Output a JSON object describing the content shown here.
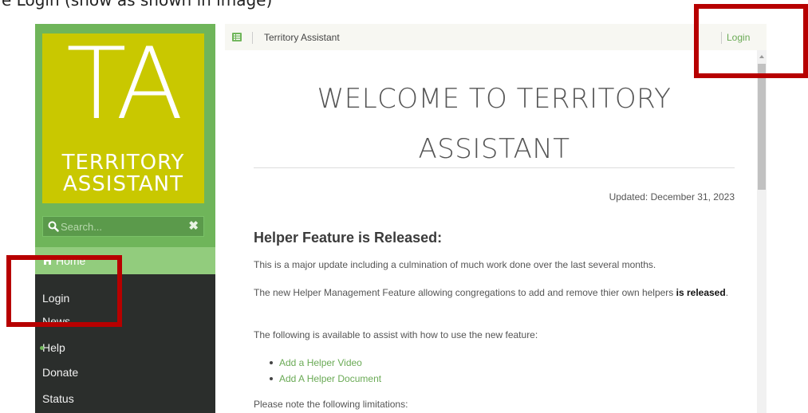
{
  "caption": "e Login (show as shown in image)",
  "sidebar": {
    "logo_big": "TA",
    "logo_line1": "TERRITORY",
    "logo_line2": "ASSISTANT",
    "search_placeholder": "Search...",
    "clear_glyph": "✖",
    "home_label": "Home",
    "items": [
      {
        "label": "Login"
      },
      {
        "label": "News"
      },
      {
        "label": "Help"
      },
      {
        "label": "Donate"
      },
      {
        "label": "Status"
      }
    ]
  },
  "header": {
    "title": "Territory Assistant",
    "login": "Login"
  },
  "content": {
    "heading_line1": "WELCOME TO TERRITORY",
    "heading_line2": "ASSISTANT",
    "updated": "Updated: December 31, 2023",
    "subheading": "Helper Feature is Released:",
    "para1": "This is a major update including a culmination of much work done over the last several months.",
    "para2_text": "The new Helper Management Feature allowing congregations to add and remove thier own helpers ",
    "para2_bold": "is released",
    "para2_end": ".",
    "para3": "The following is available to assist with how to use the new feature:",
    "links": [
      "Add a Helper Video",
      "Add A Helper Document"
    ],
    "para4": "Please note the following limitations:"
  },
  "colors": {
    "sidebar_green": "#6fb55a",
    "logo_yellow": "#c9c800",
    "sidebar_dark": "#2b2e2c",
    "link_green": "#6aaa55",
    "annotation_red": "#b70000"
  }
}
